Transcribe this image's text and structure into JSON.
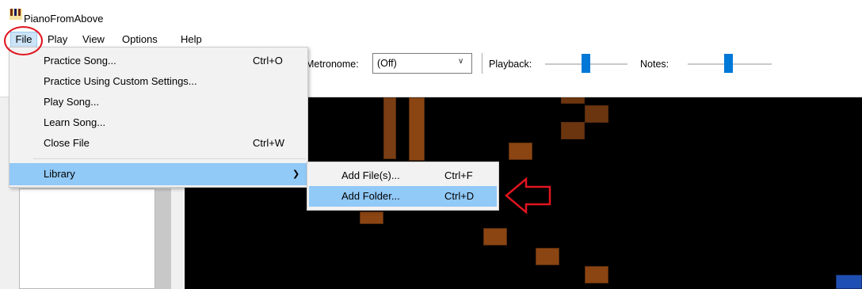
{
  "window": {
    "title": "PianoFromAbove"
  },
  "menubar": {
    "items": [
      {
        "label": "File"
      },
      {
        "label": "Play"
      },
      {
        "label": "View"
      },
      {
        "label": "Options"
      },
      {
        "label": "Help"
      }
    ]
  },
  "toolbar": {
    "metronome_label": "Metronome:",
    "metronome_value": "(Off)",
    "playback_label": "Playback:",
    "playback_level_percent": 45,
    "notes_label": "Notes:",
    "notes_level_percent": 45
  },
  "file_menu": {
    "items": [
      {
        "label": "Practice Song...",
        "shortcut": "Ctrl+O"
      },
      {
        "label": "Practice Using Custom Settings...",
        "shortcut": ""
      },
      {
        "label": "Play Song...",
        "shortcut": ""
      },
      {
        "label": "Learn Song...",
        "shortcut": ""
      },
      {
        "label": "Close File",
        "shortcut": "Ctrl+W"
      },
      {
        "label": "Library",
        "shortcut": ""
      }
    ]
  },
  "library_menu": {
    "items": [
      {
        "label": "Add File(s)...",
        "shortcut": "Ctrl+F"
      },
      {
        "label": "Add Folder...",
        "shortcut": "Ctrl+D"
      }
    ]
  },
  "colors": {
    "menu_highlight": "#91c9f7",
    "slider_thumb": "#0078d7",
    "annotation_red": "#e0151f",
    "note_brown": "#8b4513"
  },
  "icons": {
    "app": "piano-icon",
    "submenu": "chevron-right-icon",
    "dropdown": "chevron-down-icon"
  }
}
